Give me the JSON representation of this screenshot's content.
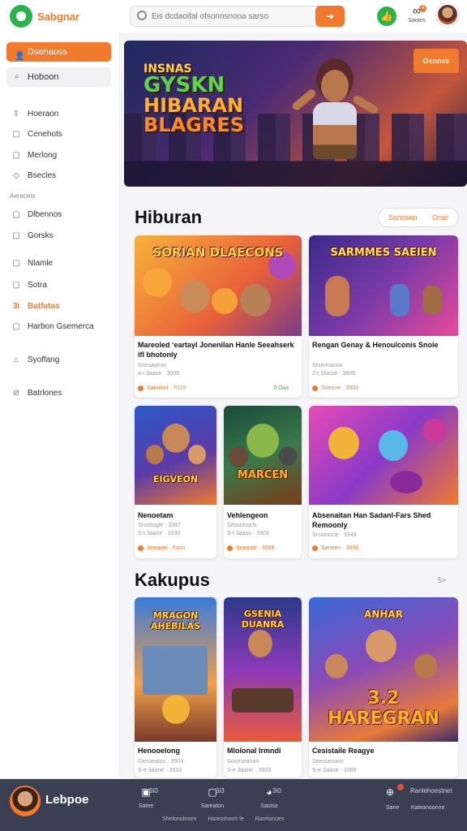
{
  "header": {
    "logo_text": "Sabgnar",
    "search_placeholder": "Eis dcdaoifal ofsonnsnooa sarso",
    "search_button_icon": "arrow-right-icon",
    "notification_label": "Saoies",
    "notification_count": "4",
    "accent_color": "#f07a2d",
    "green_color": "#2bb34b"
  },
  "sidebar": {
    "primary_button": "Dsenaoss",
    "secondary_button": "Hoboon",
    "items": [
      {
        "label": "Hoeraon",
        "icon": "upload-icon"
      },
      {
        "label": "Cenehots",
        "icon": "box-icon"
      },
      {
        "label": "Merlong",
        "icon": "box-icon"
      },
      {
        "label": "Bsecles",
        "icon": "tag-icon"
      }
    ],
    "section_heading": "Aerecets",
    "items2": [
      {
        "label": "Dlbennos",
        "icon": "box-icon"
      },
      {
        "label": "Gorsks",
        "icon": "box-icon"
      },
      {
        "label": "Nlamle",
        "icon": "box-icon"
      },
      {
        "label": "Sotra",
        "icon": "box-icon"
      },
      {
        "label": "Batfatas",
        "icon": "tag-icon",
        "active": true,
        "prefix": "3i"
      },
      {
        "label": "Harbon Gsemerca",
        "icon": "box-icon"
      },
      {
        "label": "Syoffang",
        "icon": "image-icon"
      },
      {
        "label": "Batrlones",
        "icon": "shield-icon"
      }
    ]
  },
  "hero": {
    "title_line1": "INSNAS",
    "title_line2": "GYSKN",
    "title_line3": "HIBARAN",
    "title_line4": "BLAGRES",
    "badge": "Osnnes"
  },
  "sections": {
    "hiburan_title": "Hiburan",
    "pill_left": "Sonnsen",
    "pill_right": "Oner",
    "kakupus_title": "Kakupus",
    "more_link": "5>"
  },
  "cards": [
    {
      "thumb_title": "SORIAN DLAECONS",
      "caption": "Mareoled ‘eartayl Jonenilan Hanle Seeahserk ifl bhotonly",
      "meta1": "Snesaornis",
      "meta2": "a-t 3aase · 3009",
      "foot_a": "Saeotorl · 7019",
      "foot_b": "0 Daa"
    },
    {
      "thumb_title": "SARMMES SAEIEN",
      "caption": "Rengan Genay & Henoulconis Snoie",
      "meta1": "Srsennanist",
      "meta2": "2-t Slsose · 3609",
      "foot_a": "Soenne · 3903",
      "foot_b": ""
    },
    {
      "thumb_title": "EIGVEON",
      "caption": "Nenoetam",
      "meta1": "Srsobsgle · 3387",
      "meta2": "S-t 3aane · 3330",
      "foot_a": "Soeanel · Faso",
      "foot_b": ""
    },
    {
      "thumb_title": "MARCEN",
      "caption": "Vehlengeon",
      "meta1": "Sessotnorls",
      "meta2": "S-t 3aaso · 3903",
      "foot_a": "Soenobl · 3088",
      "foot_b": ""
    },
    {
      "thumb_title": "",
      "caption": "Absenaitan Han Sadanl-Fars Shed Remoonly",
      "meta1": "Srsoinocie · 3349",
      "meta2": "",
      "foot_a": "Saneen · 3849",
      "foot_b": ""
    },
    {
      "thumb_title": "MRAGON AHEBILAS",
      "caption": "Henooelong",
      "meta1": "Genoeatos · 3503",
      "meta2": "S-e 3aane · 3933",
      "foot_a": "",
      "foot_b": ""
    },
    {
      "thumb_title": "GSENIA DUANRA",
      "caption": "Mlolonal Irmndi",
      "meta1": "Sonnseanan",
      "meta2": "S-e 3aane · 3903",
      "foot_a": "",
      "foot_b": ""
    },
    {
      "thumb_title": "3.2 HAREGRAN",
      "caption": "Cesistaile Reagye",
      "meta1": "Seesseoaon",
      "meta2": "S-e Saase · 3369",
      "foot_a": "",
      "foot_b": ""
    }
  ],
  "bottombar": {
    "username": "Lebpoe",
    "tabs": [
      {
        "icon": "image-icon",
        "label": "Satee",
        "count": "3i0"
      },
      {
        "icon": "box-icon",
        "label": "Sareaton",
        "count": "3i3"
      },
      {
        "icon": "controller-icon",
        "label": "Saoiso",
        "count": "3i0"
      },
      {
        "icon": "gift-icon",
        "label": "Sane",
        "count": "Ranlehoestnet"
      }
    ],
    "tab4_sub": "Kateanoonne",
    "links": [
      "Shelonolosen",
      "Hareorhoon le",
      "Rarelanoes"
    ]
  }
}
